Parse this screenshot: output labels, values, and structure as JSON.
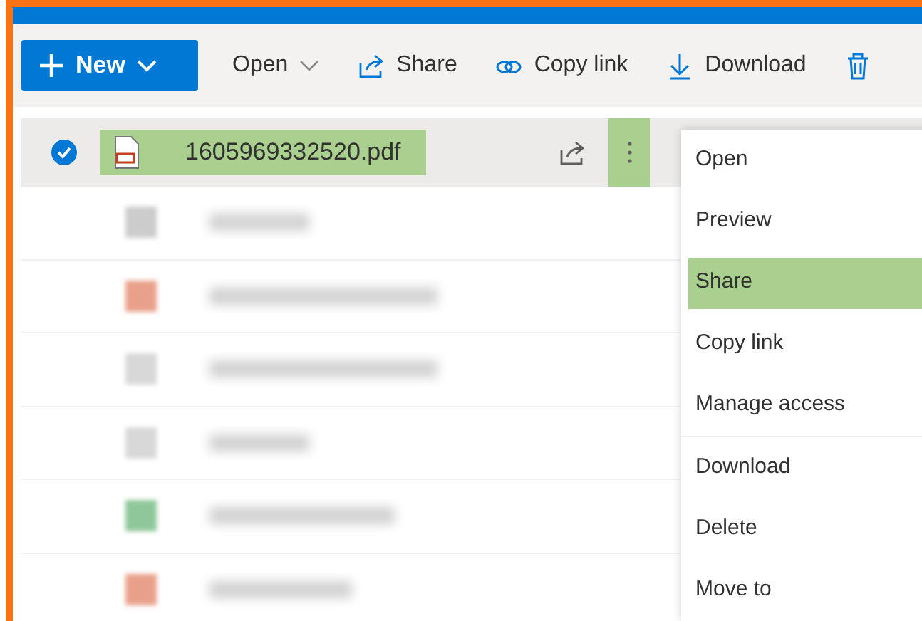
{
  "toolbar": {
    "new_button": {
      "label": "New"
    },
    "items": [
      {
        "kind": "menu",
        "label": "Open",
        "caret": true
      },
      {
        "kind": "share",
        "label": "Share",
        "caret": false
      },
      {
        "kind": "link",
        "label": "Copy link",
        "caret": false
      },
      {
        "kind": "download",
        "label": "Download",
        "caret": false
      },
      {
        "kind": "trash",
        "caret": false
      }
    ]
  },
  "file": {
    "name": "1605969332520.pdf",
    "selected": true,
    "highlighted": true,
    "more_highlighted": true
  },
  "hidden_rows": [
    {
      "color": "#cccccc"
    },
    {
      "color": "#e8a08a"
    },
    {
      "color": "#d8d8d8"
    },
    {
      "color": "#d8d8d8"
    },
    {
      "color": "#8fc79a"
    },
    {
      "color": "#e8a08a"
    }
  ],
  "context_menu": [
    {
      "label": "Open",
      "selected": false,
      "divider_after": false
    },
    {
      "label": "Preview",
      "selected": false,
      "divider_after": false
    },
    {
      "label": "Share",
      "selected": true,
      "divider_after": false
    },
    {
      "label": "Copy link",
      "selected": false,
      "divider_after": false
    },
    {
      "label": "Manage access",
      "selected": false,
      "divider_after": true
    },
    {
      "label": "Download",
      "selected": false,
      "divider_after": false
    },
    {
      "label": "Delete",
      "selected": false,
      "divider_after": false
    },
    {
      "label": "Move to",
      "selected": false,
      "divider_after": false
    }
  ]
}
